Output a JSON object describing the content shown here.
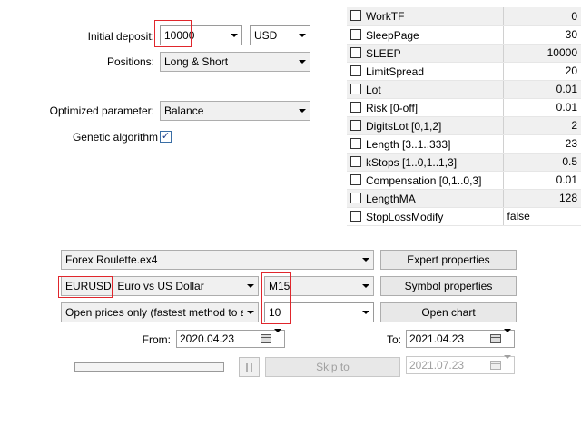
{
  "settings": {
    "initial_deposit_label": "Initial deposit:",
    "initial_deposit_value": "10000",
    "currency_value": "USD",
    "positions_label": "Positions:",
    "positions_value": "Long & Short",
    "optimized_parameter_label": "Optimized parameter:",
    "optimized_parameter_value": "Balance",
    "genetic_algorithm_label": "Genetic algorithm",
    "genetic_algorithm_checked": true,
    "checkmark_glyph": "✓"
  },
  "parameters": [
    {
      "name": "WorkTF",
      "value": "0",
      "checked": false
    },
    {
      "name": "SleepPage",
      "value": "30",
      "checked": false
    },
    {
      "name": "SLEEP",
      "value": "10000",
      "checked": false
    },
    {
      "name": "LimitSpread",
      "value": "20",
      "checked": false
    },
    {
      "name": "Lot",
      "value": "0.01",
      "checked": false
    },
    {
      "name": "Risk [0-off]",
      "value": "0.01",
      "checked": false
    },
    {
      "name": "DigitsLot [0,1,2]",
      "value": "2",
      "checked": false
    },
    {
      "name": "Length [3..1..333]",
      "value": "23",
      "checked": false
    },
    {
      "name": "kStops [1..0,1..1,3]",
      "value": "0.5",
      "checked": false
    },
    {
      "name": "Compensation [0,1..0,3]",
      "value": "0.01",
      "checked": false
    },
    {
      "name": "LengthMA",
      "value": "128",
      "checked": false
    },
    {
      "name": "StopLossModify",
      "value": "false",
      "checked": false
    }
  ],
  "tester": {
    "expert_value": "Forex Roulette.ex4",
    "symbol_value": "EURUSD, Euro vs US Dollar",
    "period_value": "M15",
    "model_value": "Open prices only (fastest method to analyze the bar just completed, only for EAs that explicitly control bar opening)",
    "spread_value": "10",
    "expert_properties_label": "Expert properties",
    "symbol_properties_label": "Symbol properties",
    "open_chart_label": "Open chart",
    "from_label": "From:",
    "from_value": "2020.04.23",
    "to_label": "To:",
    "to_value": "2021.04.23",
    "skip_to_label": "Skip to",
    "skip_to_value": "2021.07.23",
    "progress_fraction": 0
  },
  "icons": {
    "dropdown": "chevron-down-icon",
    "calendar": "calendar-icon",
    "pause": "pause-icon",
    "checkbox": "checkbox-icon"
  },
  "colors": {
    "highlight_border": "#e0262c",
    "progress_fill": "#06b025",
    "checkmark": "#1e3f8a"
  }
}
